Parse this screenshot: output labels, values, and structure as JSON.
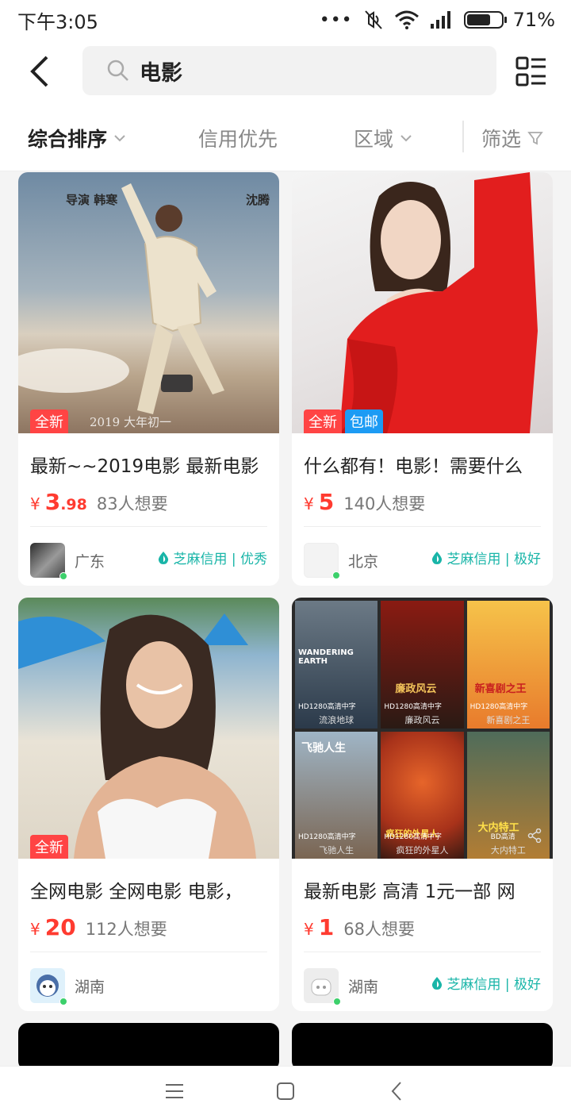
{
  "status_bar": {
    "time": "下午3:05",
    "battery": "71%",
    "signal_dots": "•••"
  },
  "search": {
    "query": "电影"
  },
  "filters": [
    {
      "label": "综合排序",
      "active": true
    },
    {
      "label": "信用优先"
    },
    {
      "label": "区域"
    },
    {
      "label": "筛选"
    }
  ],
  "products": [
    {
      "badges": [
        "全新"
      ],
      "title": "最新~~2019电影 最新电影",
      "price_int": "3",
      "price_dec": ".98",
      "wants": "83人想要",
      "region": "广东",
      "credit": "芝麻信用 | 优秀",
      "image_text": {
        "left": "导演 韩寒",
        "right": "沈腾",
        "bottom": "2019 大年初一"
      }
    },
    {
      "badges": [
        "全新",
        "包邮"
      ],
      "title": "什么都有！电影！需要什么",
      "price_int": "5",
      "price_dec": "",
      "wants": "140人想要",
      "region": "北京",
      "credit": "芝麻信用 | 极好"
    },
    {
      "badges": [
        "全新"
      ],
      "title": "全网电影 全网电影 电影，",
      "price_int": "20",
      "price_dec": "",
      "wants": "112人想要",
      "region": "湖南",
      "credit": ""
    },
    {
      "badges": [],
      "title": "最新电影 高清 1元一部 网",
      "price_int": "1",
      "price_dec": "",
      "wants": "68人想要",
      "region": "湖南",
      "credit": "芝麻信用 | 极好",
      "posters": [
        {
          "caption": "流浪地球",
          "label": "HD1280高清中字",
          "title": "WANDERING EARTH"
        },
        {
          "caption": "廉政风云",
          "label": "HD1280高清中字",
          "title": "廉政风云"
        },
        {
          "caption": "新喜剧之王",
          "label": "HD1280高清中字",
          "title": "新喜剧之王"
        },
        {
          "caption": "飞驰人生",
          "label": "HD1280高清中字",
          "title": "飞驰人生"
        },
        {
          "caption": "疯狂的外星人",
          "label": "HD1280高清中字",
          "title": "疯狂的外星人"
        },
        {
          "caption": "大内特工",
          "label": "BD高清",
          "title": "大内特工"
        }
      ]
    }
  ],
  "colors": {
    "accent_red": "#ff3b30",
    "credit_teal": "#19b5a8",
    "ship_blue": "#1c9bf4"
  }
}
